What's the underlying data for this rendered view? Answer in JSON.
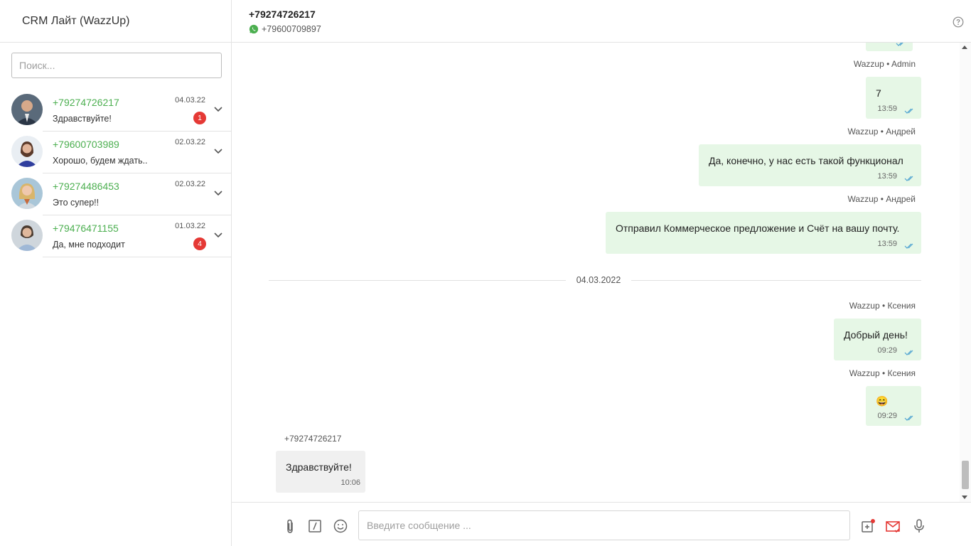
{
  "sidebar": {
    "title": "CRM Лайт (WazzUp)",
    "search": {
      "placeholder": "Поиск...",
      "value": ""
    },
    "chats": [
      {
        "phone": "+79274726217",
        "preview": "Здравствуйте!",
        "date": "04.03.22",
        "unread": "1"
      },
      {
        "phone": "+79600703989",
        "preview": "Хорошо, будем ждать..",
        "date": "02.03.22",
        "unread": ""
      },
      {
        "phone": "+79274486453",
        "preview": "Это супер!!",
        "date": "02.03.22",
        "unread": ""
      },
      {
        "phone": "+79476471155",
        "preview": "Да, мне подходит",
        "date": "01.03.22",
        "unread": "4"
      }
    ]
  },
  "header": {
    "contact_phone": "+79274726217",
    "channel_phone": "+79600709897"
  },
  "messages": [
    {
      "author": "Wazzup • Admin",
      "text": "7",
      "time": "13:59"
    },
    {
      "author": "Wazzup • Андрей",
      "text": "Да, конечно, у нас есть такой функционал",
      "time": "13:59"
    },
    {
      "author": "Wazzup • Андрей",
      "text": "Отправил Коммерческое предложение и Счёт на вашу почту.",
      "time": "13:59"
    },
    {
      "author": "Wazzup • Ксения",
      "text": "Добрый день!",
      "time": "09:29"
    },
    {
      "author": "Wazzup • Ксения",
      "text": "😄",
      "time": "09:29"
    },
    {
      "author": "+79274726217",
      "text": "Здравствуйте!",
      "time": "10:06"
    }
  ],
  "date_separator": "04.03.2022",
  "composer": {
    "placeholder": "Введите сообщение ...",
    "value": ""
  },
  "colors": {
    "accent_green": "#4caf50",
    "outgoing_bubble": "#e6f7e6",
    "incoming_bubble": "#f0f0f0",
    "badge_red": "#e53935",
    "tick_blue": "#4fa3d1",
    "email_red": "#e53935"
  },
  "icons": [
    "whatsapp-icon",
    "help-icon",
    "chevron-down-icon",
    "attach-icon",
    "template-icon",
    "emoji-icon",
    "task-icon",
    "email-icon",
    "microphone-icon",
    "double-check-icon"
  ]
}
